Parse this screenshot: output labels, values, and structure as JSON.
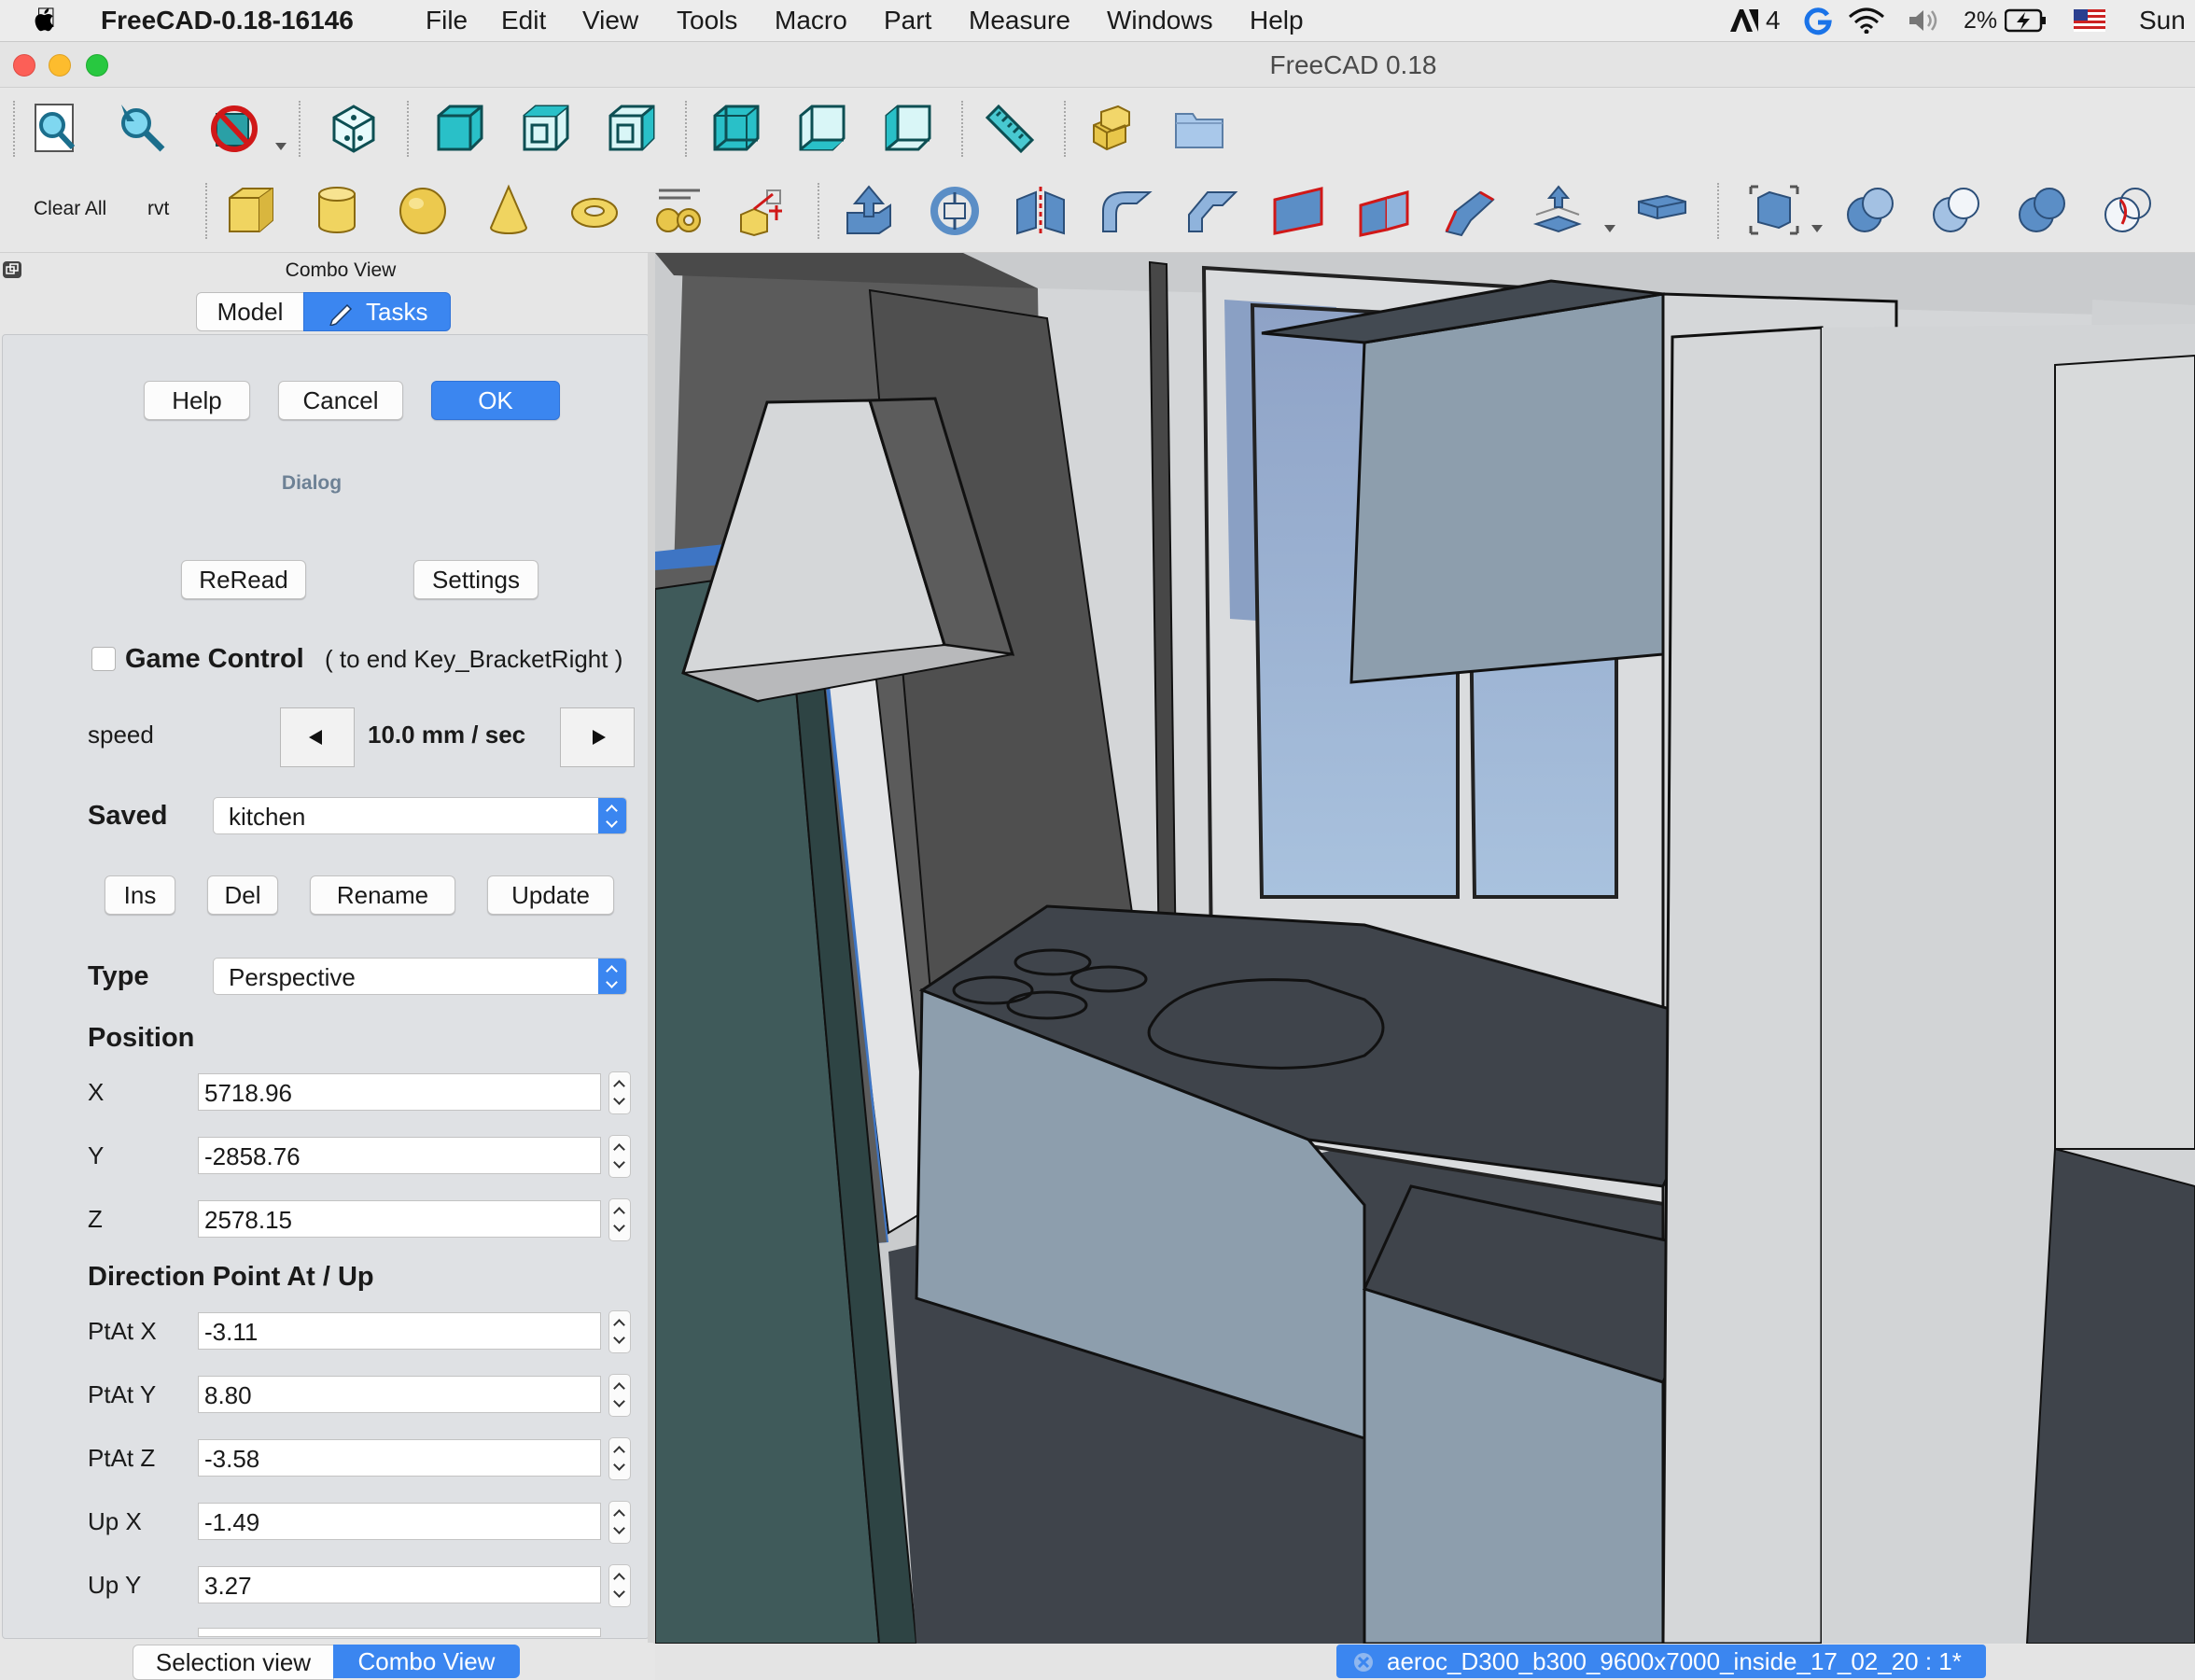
{
  "menubar": {
    "app_name": "FreeCAD-0.18-16146",
    "menus": [
      "File",
      "Edit",
      "View",
      "Tools",
      "Macro",
      "Part",
      "Measure",
      "Windows",
      "Help"
    ],
    "status": {
      "notif_count": "4",
      "battery": "2%",
      "clock": "Sun"
    }
  },
  "window": {
    "title": "FreeCAD 0.18"
  },
  "toolbar2": {
    "clear_all": "Clear All",
    "rvt": "rvt"
  },
  "combo": {
    "title": "Combo View",
    "tabs": {
      "model": "Model",
      "tasks": "Tasks"
    },
    "buttons": {
      "help": "Help",
      "cancel": "Cancel",
      "ok": "OK"
    },
    "dialog_label": "Dialog",
    "reread": "ReRead",
    "settings": "Settings",
    "game_control": {
      "label": "Game Control",
      "hint": "( to end Key_BracketRight )",
      "checked": false
    },
    "speed": {
      "label": "speed",
      "value": "10.0 mm / sec"
    },
    "saved": {
      "label": "Saved",
      "value": "kitchen"
    },
    "saved_buttons": {
      "ins": "Ins",
      "del": "Del",
      "rename": "Rename",
      "update": "Update"
    },
    "type": {
      "label": "Type",
      "value": "Perspective"
    },
    "position": {
      "label": "Position",
      "x_label": "X",
      "x": "5718.96",
      "y_label": "Y",
      "y": "-2858.76",
      "z_label": "Z",
      "z": "2578.15"
    },
    "direction": {
      "label": "Direction Point At / Up",
      "ptat_x_label": "PtAt X",
      "ptat_x": "-3.11",
      "ptat_y_label": "PtAt Y",
      "ptat_y": "8.80",
      "ptat_z_label": "PtAt Z",
      "ptat_z": "-3.58",
      "up_x_label": "Up X",
      "up_x": "-1.49",
      "up_y_label": "Up Y",
      "up_y": "3.27"
    }
  },
  "bottom": {
    "selection_view": "Selection view",
    "combo_view": "Combo View",
    "document_tab": "aeroc_D300_b300_9600x7000_inside_17_02_20 : 1*"
  },
  "colors": {
    "accent": "#3b86f0",
    "toolbar_icon": "#29c0c8"
  }
}
